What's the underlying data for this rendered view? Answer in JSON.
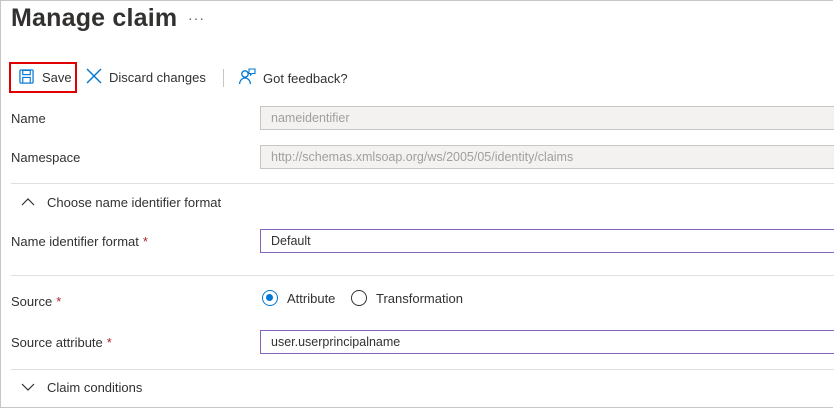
{
  "header": {
    "title": "Manage claim",
    "more": "···"
  },
  "toolbar": {
    "save_label": "Save",
    "discard_label": "Discard changes",
    "feedback_label": "Got feedback?"
  },
  "form": {
    "name": {
      "label": "Name",
      "value": "nameidentifier"
    },
    "namespace": {
      "label": "Namespace",
      "value": "http://schemas.xmlsoap.org/ws/2005/05/identity/claims"
    },
    "name_id_section": "Choose name identifier format",
    "name_id_format": {
      "label": "Name identifier format",
      "required_mark": "*",
      "value": "Default"
    },
    "source": {
      "label": "Source",
      "required_mark": "*",
      "options": [
        {
          "label": "Attribute",
          "checked": true
        },
        {
          "label": "Transformation",
          "checked": false
        }
      ]
    },
    "source_attribute": {
      "label": "Source attribute",
      "required_mark": "*",
      "value": "user.userprincipalname"
    },
    "claim_conditions_section": "Claim conditions"
  },
  "colors": {
    "accent": "#0078d4",
    "highlight_border": "#e00000",
    "focus_border": "#8764b8",
    "required": "#a4262c"
  }
}
